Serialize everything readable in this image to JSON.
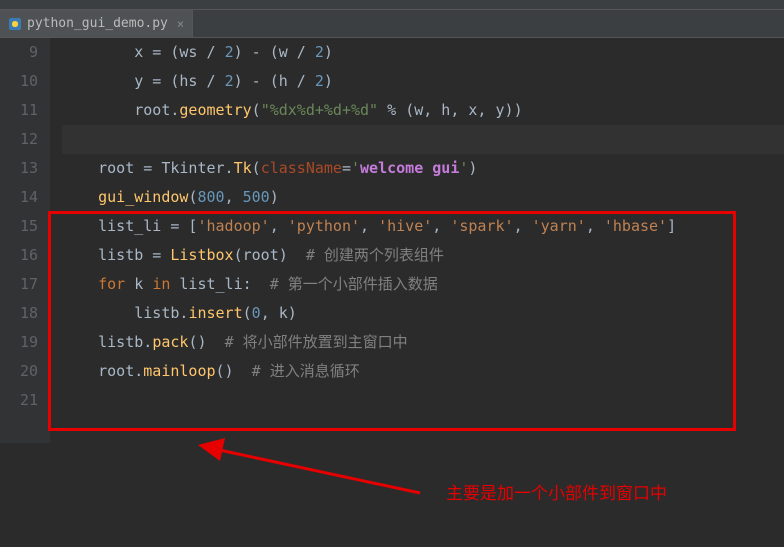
{
  "tab": {
    "filename": "python_gui_demo.py"
  },
  "gutter": {
    "lines": [
      "9",
      "10",
      "11",
      "12",
      "13",
      "14",
      "15",
      "16",
      "17",
      "18",
      "19",
      "20",
      "21"
    ]
  },
  "code": {
    "l9": {
      "indent": "        ",
      "v1": "x",
      "eq": " = (",
      "v2": "ws",
      "div1": " / ",
      "n1": "2",
      "mid": ") - (",
      "v3": "w",
      "div2": " / ",
      "n2": "2",
      "end": ")"
    },
    "l10": {
      "indent": "        ",
      "v1": "y",
      "eq": " = (",
      "v2": "hs",
      "div1": " / ",
      "n1": "2",
      "mid": ") - (",
      "v3": "h",
      "div2": " / ",
      "n2": "2",
      "end": ")"
    },
    "l11": {
      "indent": "        ",
      "obj": "root.",
      "fn": "geometry",
      "open": "(",
      "str": "\"%dx%d+%d+%d\"",
      "pct": " % ",
      "args": "(w, h, x, y)",
      "close": ")"
    },
    "l12": {
      "content": ""
    },
    "l13": {
      "indent": "    ",
      "v": "root = Tkinter.",
      "fn": "Tk",
      "open": "(",
      "param": "className",
      "eq": "=",
      "q1": "'",
      "str": "welcome gui",
      "q2": "'",
      "close": ")"
    },
    "l14": {
      "indent": "    ",
      "fn": "gui_window",
      "open": "(",
      "n1": "800",
      "comma": ", ",
      "n2": "500",
      "close": ")"
    },
    "l15": {
      "indent": "    ",
      "v": "list_li = [",
      "s1": "'hadoop'",
      "c1": ", ",
      "s2": "'python'",
      "c2": ", ",
      "s3": "'hive'",
      "c3": ", ",
      "s4": "'spark'",
      "c4": ", ",
      "s5": "'yarn'",
      "c5": ", ",
      "s6": "'hbase'",
      "close": "]"
    },
    "l16": {
      "indent": "    ",
      "v": "listb = ",
      "fn": "Listbox",
      "args": "(root)  ",
      "cmt": "# 创建两个列表组件"
    },
    "l17": {
      "indent": "    ",
      "kw1": "for",
      "v1": " k ",
      "kw2": "in",
      "v2": " list_li:  ",
      "cmt": "# 第一个小部件插入数据"
    },
    "l18": {
      "indent": "        ",
      "obj": "listb.",
      "fn": "insert",
      "open": "(",
      "n": "0",
      "rest": ", k)"
    },
    "l19": {
      "indent": "    ",
      "obj": "listb.",
      "fn": "pack",
      "args": "()  ",
      "cmt": "# 将小部件放置到主窗口中"
    },
    "l20": {
      "indent": "    ",
      "obj": "root.",
      "fn": "mainloop",
      "args": "()  ",
      "cmt": "# 进入消息循环"
    },
    "l21": {
      "content": ""
    }
  },
  "annotation": {
    "text": "主要是加一个小部件到窗口中"
  }
}
